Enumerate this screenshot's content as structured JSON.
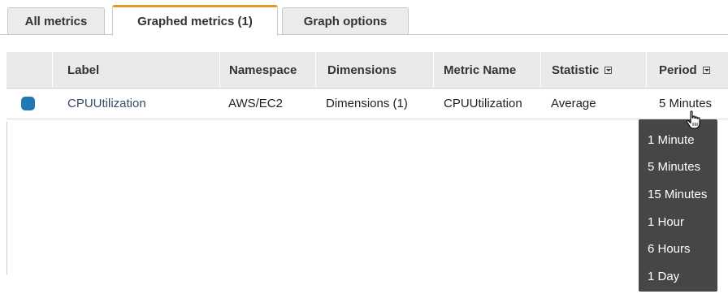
{
  "tabs": [
    {
      "label": "All metrics",
      "active": false
    },
    {
      "label": "Graphed metrics (1)",
      "active": true
    },
    {
      "label": "Graph options",
      "active": false
    }
  ],
  "colors": {
    "active_tab_accent": "#e89923",
    "series_swatch": "#1f77b4",
    "dropdown_bg": "#464646"
  },
  "table": {
    "columns": {
      "label": "Label",
      "namespace": "Namespace",
      "dimensions": "Dimensions",
      "metric_name": "Metric Name",
      "statistic": "Statistic",
      "period": "Period"
    },
    "rows": [
      {
        "label": "CPUUtilization",
        "namespace": "AWS/EC2",
        "dimensions": "Dimensions (1)",
        "metric_name": "CPUUtilization",
        "statistic": "Average",
        "period": "5 Minutes"
      }
    ]
  },
  "period_dropdown": {
    "options": [
      "1 Minute",
      "5 Minutes",
      "15 Minutes",
      "1 Hour",
      "6 Hours",
      "1 Day"
    ]
  },
  "icons": {
    "sort": "dropdown-box-icon",
    "cursor": "hand-pointer-icon"
  }
}
